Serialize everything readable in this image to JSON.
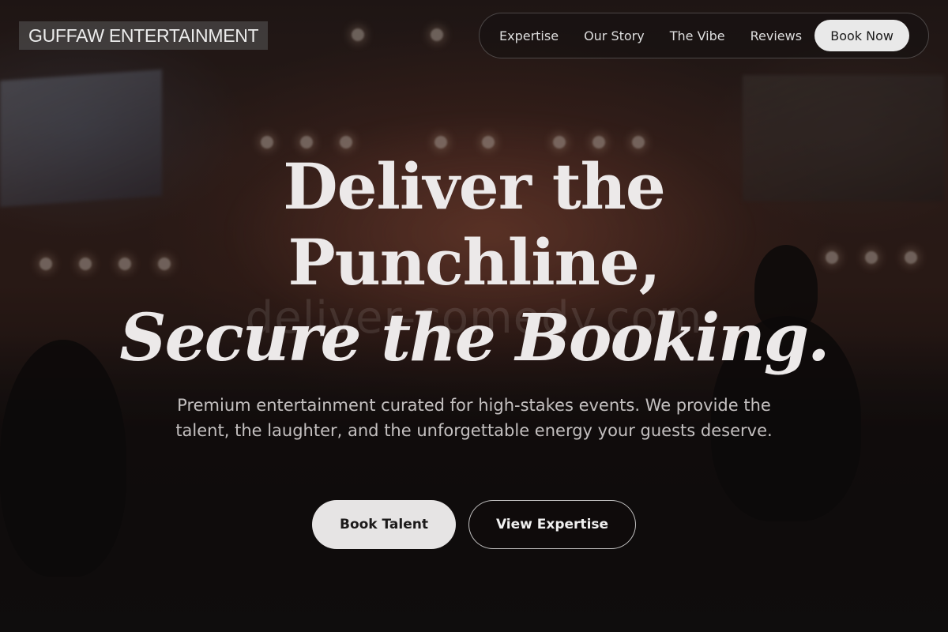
{
  "header": {
    "brand": "GUFFAW ENTERTAINMENT",
    "nav": [
      {
        "label": "Expertise"
      },
      {
        "label": "Our Story"
      },
      {
        "label": "The Vibe"
      },
      {
        "label": "Reviews"
      }
    ],
    "cta_label": "Book Now"
  },
  "hero": {
    "title_line1": "Deliver the",
    "title_line2": "Punchline,",
    "title_line3": "Secure the Booking.",
    "watermark": "deliver-comedy.com",
    "subtitle": "Premium entertainment curated for high-stakes events. We provide the talent, the laughter, and the unforgettable energy your guests deserve.",
    "primary_button": "Book Talent",
    "secondary_button": "View Expertise"
  },
  "colors": {
    "background": "#151111",
    "text": "#ece9e9",
    "button_light": "#e6e4e4"
  }
}
